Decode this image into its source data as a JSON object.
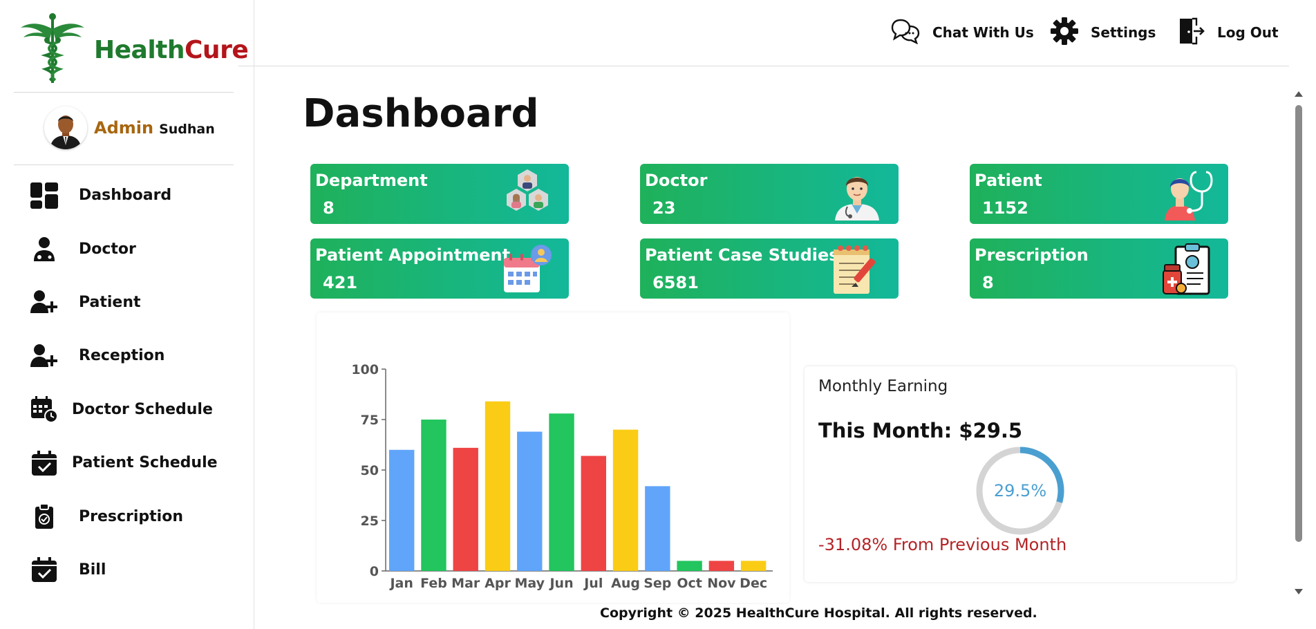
{
  "brand": {
    "part1": "Health",
    "part2": "Cure"
  },
  "user": {
    "role": "Admin",
    "name": "Sudhan"
  },
  "sidebar": {
    "items": [
      {
        "label": "Dashboard",
        "icon": "dashboard-icon"
      },
      {
        "label": "Doctor",
        "icon": "doctor-icon"
      },
      {
        "label": "Patient",
        "icon": "add-user-icon"
      },
      {
        "label": "Reception",
        "icon": "add-user-icon"
      },
      {
        "label": "Doctor Schedule",
        "icon": "calendar-clock-icon"
      },
      {
        "label": "Patient Schedule",
        "icon": "calendar-check-icon"
      },
      {
        "label": "Prescription",
        "icon": "clipboard-check-icon"
      },
      {
        "label": "Bill",
        "icon": "calendar-check-icon"
      }
    ]
  },
  "header": {
    "chat_label": "Chat With Us",
    "settings_label": "Settings",
    "logout_label": "Log Out"
  },
  "page": {
    "title": "Dashboard"
  },
  "cards": [
    {
      "label": "Department",
      "value": "8",
      "icon": "department-icon"
    },
    {
      "label": "Doctor",
      "value": "23",
      "icon": "doctor-avatar-icon"
    },
    {
      "label": "Patient",
      "value": "1152",
      "icon": "patient-icon"
    },
    {
      "label": "Patient Appointment",
      "value": "421",
      "icon": "appointment-calendar-icon"
    },
    {
      "label": "Patient Case Studies",
      "value": "6581",
      "icon": "case-study-notepad-icon"
    },
    {
      "label": "Prescription",
      "value": "8",
      "icon": "prescription-clipboard-icon"
    }
  ],
  "chart_data": {
    "type": "bar",
    "categories": [
      "Jan",
      "Feb",
      "Mar",
      "Apr",
      "May",
      "Jun",
      "Jul",
      "Aug",
      "Sep",
      "Oct",
      "Nov",
      "Dec"
    ],
    "values": [
      60,
      75,
      61,
      84,
      69,
      78,
      57,
      70,
      42,
      5,
      5,
      5
    ],
    "colors": [
      "#60a5fa",
      "#22c55e",
      "#ef4444",
      "#facc15",
      "#60a5fa",
      "#22c55e",
      "#ef4444",
      "#facc15",
      "#60a5fa",
      "#22c55e",
      "#ef4444",
      "#facc15"
    ],
    "yticks": [
      "0",
      "25",
      "50",
      "75",
      "100"
    ],
    "ylim": [
      0,
      100
    ],
    "title": "",
    "xlabel": "",
    "ylabel": "",
    "grid": false
  },
  "earning": {
    "title": "Monthly Earning",
    "this_month": "This Month: $29.5",
    "percent_label": "29.5%",
    "percent_value": 29.5,
    "change": "-31.08% From Previous Month",
    "ring_color": "#4a9fd1",
    "track_color": "#d4d4d4"
  },
  "footer": {
    "text": "Copyright © 2025 HealthCure Hospital. All rights reserved."
  }
}
